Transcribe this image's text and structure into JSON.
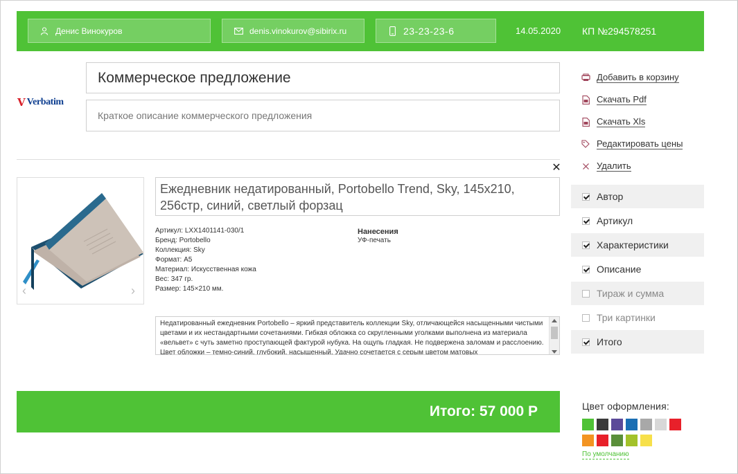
{
  "header": {
    "name": "Денис Винокуров",
    "email": "denis.vinokurov@sibirix.ru",
    "phone": "23-23-23-6",
    "date": "14.05.2020",
    "kp": "КП №294578251"
  },
  "logo": {
    "text": "Verbatim"
  },
  "offer": {
    "title": "Коммерческое предложение",
    "description_placeholder": "Краткое описание коммерческого предложения"
  },
  "product": {
    "title": "Ежедневник недатированный, Portobello Trend, Sky, 145х210, 256стр, синий, светлый форзац",
    "props": [
      "Артикул: LXX1401141-030/1",
      "Бренд: Portobello",
      "Коллекция: Sky",
      "Формат: А5",
      "Материал: Искусственная кожа",
      "Вес: 347 гр.",
      "Размер: 145×210 мм."
    ],
    "application_title": "Нанесения",
    "application_value": "УФ-печать",
    "description": "Недатированный ежедневник Portobello – яркий представитель коллекции Sky, отличающейся насыщенными чистыми цветами и их нестандартными сочетаниями. Гибкая обложка со скругленными уголками выполнена из материала «вельвет» с чуть заметно проступающей фактурой нубука. На ощупь гладкая. Не подвержена заломам и расслоению. Цвет обложки – темно-синий, глубокий, насыщенный. Удачно сочетается с серым цветом матовых"
  },
  "total": "Итого: 57 000 Р",
  "actions": [
    {
      "label": "Добавить в корзину",
      "icon": "cart-icon"
    },
    {
      "label": "Скачать Pdf",
      "icon": "pdf-icon"
    },
    {
      "label": "Скачать Xls",
      "icon": "xls-icon"
    },
    {
      "label": "Редактировать цены",
      "icon": "tag-icon"
    },
    {
      "label": "Удалить",
      "icon": "close-icon"
    }
  ],
  "checks": [
    {
      "label": "Автор",
      "checked": true
    },
    {
      "label": "Артикул",
      "checked": true
    },
    {
      "label": "Характеристики",
      "checked": true
    },
    {
      "label": "Описание",
      "checked": true
    },
    {
      "label": "Тираж и сумма",
      "checked": false
    },
    {
      "label": "Три картинки",
      "checked": false
    },
    {
      "label": "Итого",
      "checked": true
    }
  ],
  "colors": {
    "title": "Цвет оформления:",
    "default_link": "По умолчанию",
    "swatches": [
      "#4fc236",
      "#3a3a3a",
      "#5b4a99",
      "#1a6eb4",
      "#a8a8a8",
      "#d8d8d8",
      "#e8202a",
      "#f39422",
      "#e8202a",
      "#5a8f3a",
      "#a3c22a",
      "#f7e04a"
    ]
  },
  "brand_color": "#4fc236"
}
